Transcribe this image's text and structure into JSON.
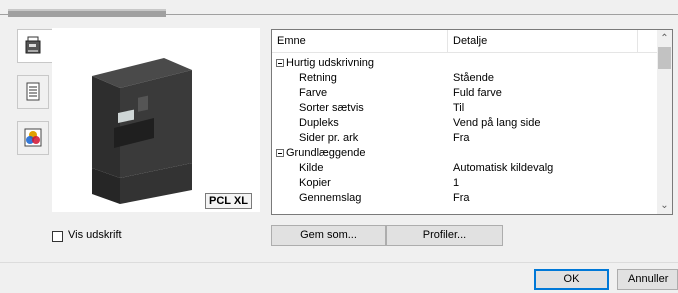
{
  "preview": {
    "badge": "PCL XL"
  },
  "tabs": [
    {
      "icon": "printer-icon",
      "active": true
    },
    {
      "icon": "document-icon",
      "active": false
    },
    {
      "icon": "color-icon",
      "active": false
    }
  ],
  "list": {
    "columns": [
      "Emne",
      "Detalje"
    ],
    "groups": [
      {
        "label": "Hurtig udskrivning",
        "rows": [
          {
            "key": "Retning",
            "value": "Stående"
          },
          {
            "key": "Farve",
            "value": "Fuld farve"
          },
          {
            "key": "Sorter sætvis",
            "value": "Til"
          },
          {
            "key": "Dupleks",
            "value": "Vend på lang side"
          },
          {
            "key": "Sider pr. ark",
            "value": "Fra"
          }
        ]
      },
      {
        "label": "Grundlæggende",
        "rows": [
          {
            "key": "Kilde",
            "value": "Automatisk kildevalg"
          },
          {
            "key": "Kopier",
            "value": "1"
          },
          {
            "key": "Gennemslag",
            "value": "Fra"
          }
        ]
      }
    ]
  },
  "checkbox": {
    "label": "Vis udskrift",
    "checked": false
  },
  "buttons": {
    "save_as": "Gem som...",
    "profiles": "Profiler...",
    "ok": "OK",
    "cancel": "Annuller"
  }
}
